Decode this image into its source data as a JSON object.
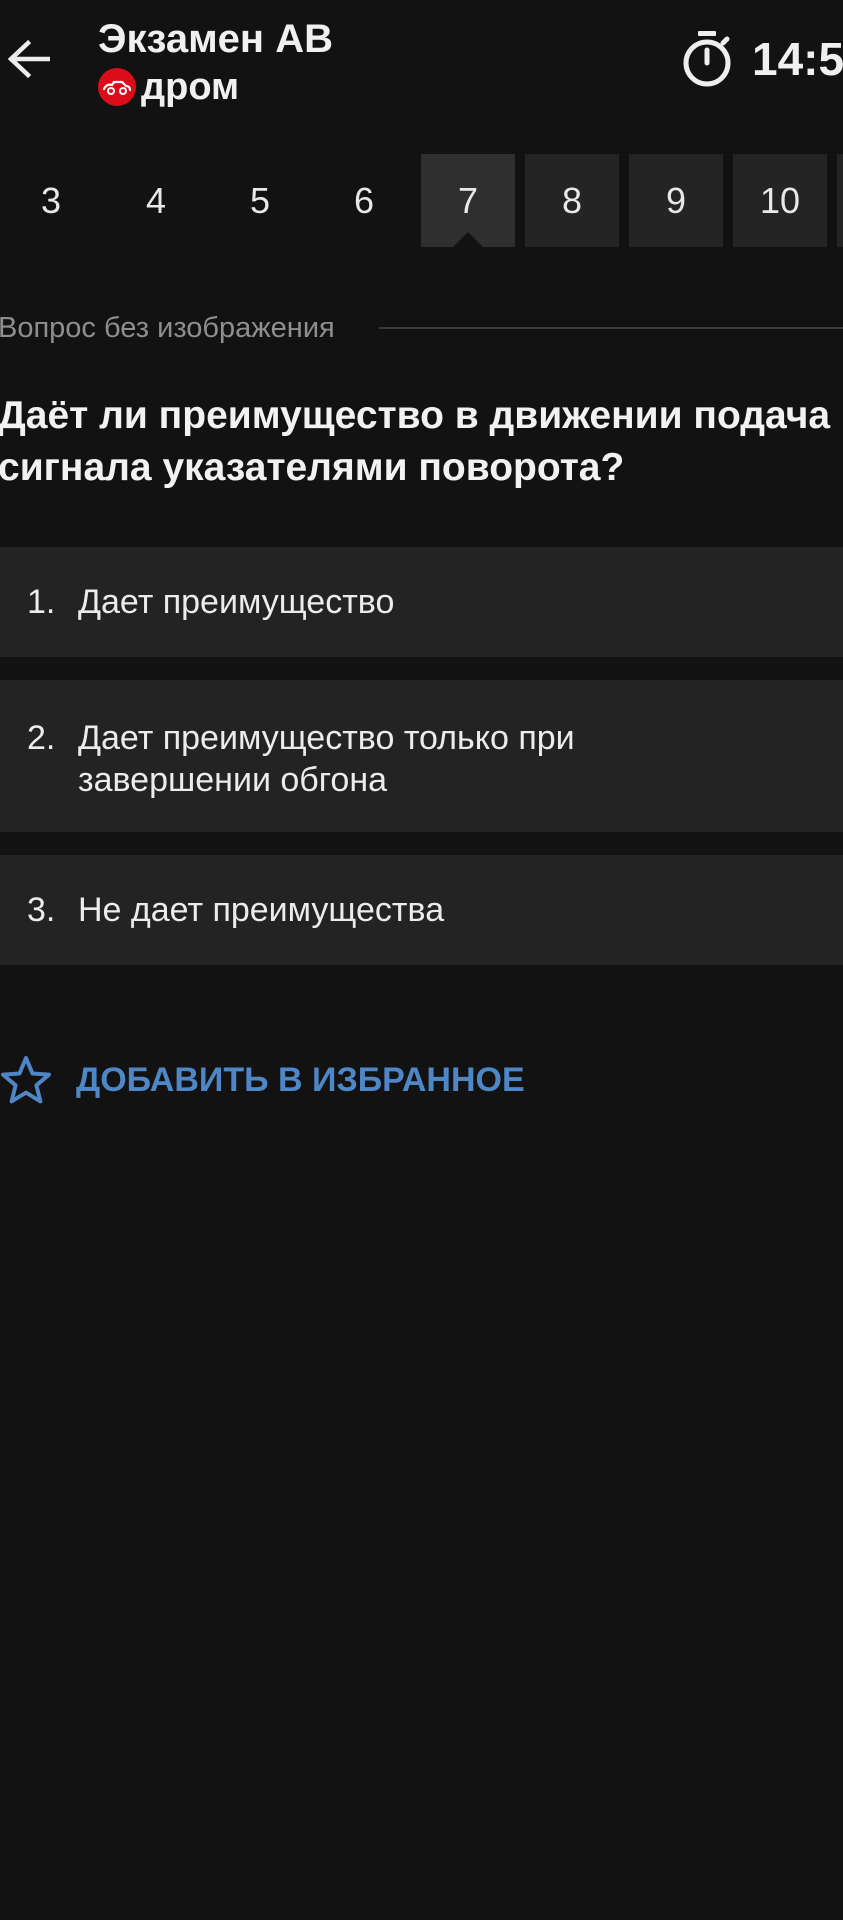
{
  "header": {
    "title": "Экзамен AB",
    "brand": "дром",
    "timer": "14:5",
    "back_icon": "arrow-left-icon",
    "timer_icon": "stopwatch-icon",
    "brand_color": "#db0d1a"
  },
  "tabs": {
    "items": [
      "3",
      "4",
      "5",
      "6",
      "7",
      "8",
      "9",
      "10"
    ],
    "active": "7"
  },
  "question": {
    "section_label": "Вопрос без изображения",
    "text": "Даёт ли преимущество в движении подача сигнала указателями поворота?"
  },
  "answers": [
    {
      "num": "1.",
      "text": "Дает преимущество"
    },
    {
      "num": "2.",
      "text": "Дает преимущество только при завершении обгона"
    },
    {
      "num": "3.",
      "text": "Не дает преимущества"
    }
  ],
  "favorite": {
    "label": "ДОБАВИТЬ В ИЗБРАННОЕ",
    "icon": "star-outline-icon",
    "color": "#4f86c6"
  },
  "colors": {
    "background": "#121213",
    "card": "#232324",
    "active_tab": "#2f2f30"
  }
}
